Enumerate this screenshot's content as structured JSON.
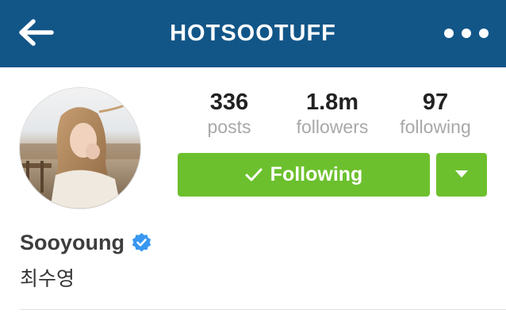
{
  "header": {
    "title": "HOTSOOTUFF",
    "back_icon": "arrow-left-icon",
    "more_icon": "more-horizontal-icon",
    "background_color": "#125688"
  },
  "profile": {
    "name": "Sooyoung",
    "subname": "최수영",
    "verified_icon": "verified-badge-icon",
    "verified_color": "#3897f0"
  },
  "stats": {
    "posts": {
      "count": "336",
      "label": "posts"
    },
    "followers": {
      "count": "1.8m",
      "label": "followers"
    },
    "following": {
      "count": "97",
      "label": "following"
    }
  },
  "actions": {
    "follow_label": "Following",
    "follow_icon": "checkmark-icon",
    "dropdown_icon": "caret-down-icon",
    "button_color": "#6cc02d"
  }
}
